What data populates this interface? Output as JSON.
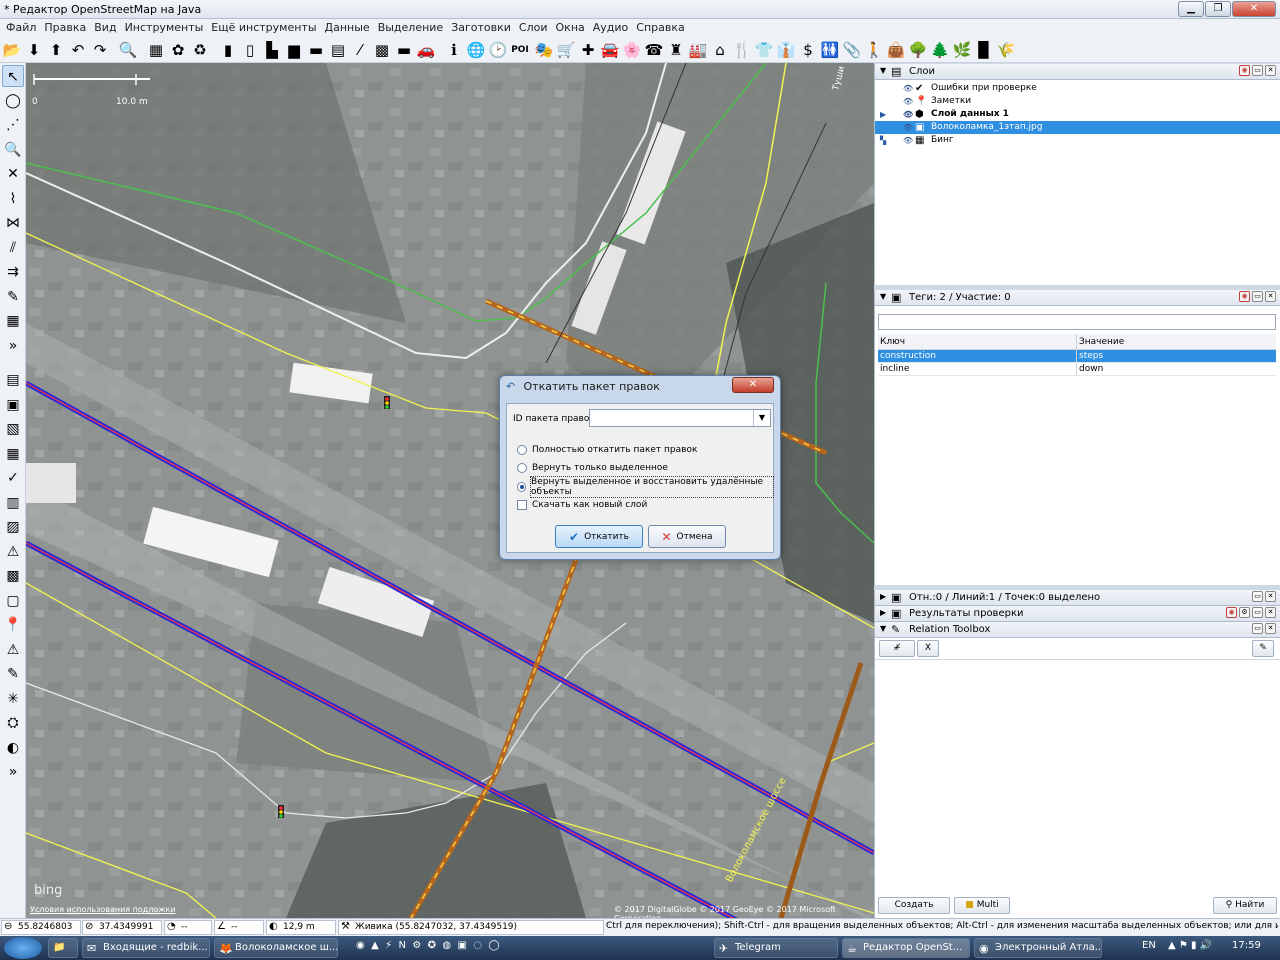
{
  "window": {
    "title": "* Редактор OpenStreetMap на Java",
    "buttons": [
      "▁",
      "❐",
      "✕"
    ]
  },
  "menu": [
    "Файл",
    "Правка",
    "Вид",
    "Инструменты",
    "Ещё инструменты",
    "Данные",
    "Выделение",
    "Заготовки",
    "Слои",
    "Окна",
    "Аудио",
    "Справка"
  ],
  "toolbar": {
    "poi_label": "POI",
    "icons": [
      "open-icon",
      "download-icon",
      "upload-icon",
      "undo-icon",
      "redo-icon",
      "preferences-icon",
      "building-icon",
      "garden-icon",
      "recycle-icon",
      "barrier-icon",
      "pole-icon",
      "gate-icon",
      "door-icon",
      "wall-icon",
      "fence-icon",
      "lines-icon",
      "hedge-icon",
      "rail-icon",
      "car-icon",
      "info-icon",
      "globe-icon",
      "clock-icon",
      "theatre-icon",
      "shop-icon",
      "hospital-icon",
      "car-repair-icon",
      "flower-icon",
      "phone-icon",
      "castle-icon",
      "factory-icon",
      "house-icon",
      "food-icon",
      "clothes-icon",
      "shirt-icon",
      "money-icon",
      "person-icon",
      "paperclip-icon",
      "walker-icon",
      "bag-icon",
      "tree-icon",
      "forest-icon",
      "grass-icon",
      "square-icon",
      "crop-icon"
    ],
    "glyphs": [
      "📂",
      "⬇",
      "⬆",
      "↶",
      "↷",
      "🔍",
      "▦",
      "✿",
      "♻",
      "▮",
      "▯",
      "▙",
      "▆",
      "▬",
      "▤",
      "⁄",
      "▩",
      "▬",
      "🚗",
      "ℹ",
      "🌐",
      "🕑",
      "🎭",
      "🛒",
      "✚",
      "🚘",
      "🌸",
      "☎",
      "♜",
      "🏭",
      "⌂",
      "🍴",
      "👕",
      "👔",
      "$",
      "🚻",
      "📎",
      "🚶",
      "👜",
      "🌳",
      "🌲",
      "🌿",
      "▉",
      "🌾"
    ]
  },
  "left_tools": [
    "select-icon",
    "lasso-icon",
    "draw-icon",
    "zoom-icon",
    "delete-icon",
    "split-icon",
    "combine-icon",
    "parallel-icon",
    "improve-icon",
    "draw-line-icon",
    "building-tool-icon",
    "more-icon",
    "layers-panel-icon",
    "properties-panel-icon",
    "selection-panel-icon",
    "relations-panel-icon",
    "validator-panel-icon",
    "history-panel-icon",
    "changeset-panel-icon",
    "conflict-panel-icon",
    "filter-panel-icon",
    "imagery-panel-icon",
    "notes-panel-icon",
    "warning-panel-icon",
    "map-paint-icon",
    "node-icon",
    "tag-icon",
    "zoom-to-icon",
    "next-icon"
  ],
  "left_glyphs": [
    "↖",
    "◯",
    "⋰",
    "🔍",
    "✕",
    "⌇",
    "⋈",
    "⫽",
    "⇉",
    "✎",
    "▦",
    "»",
    "▤",
    "▣",
    "▧",
    "▦",
    "✓",
    "▥",
    "▨",
    "⚠",
    "▩",
    "▢",
    "📍",
    "⚠",
    "✎",
    "✳",
    "⛭",
    "◐",
    "»"
  ],
  "map": {
    "scale_start": "0",
    "scale_label": "10.0 m",
    "bing_logo": "bing",
    "terms": "Условия использования подложки",
    "copyright": "© 2017 DigitalGlobe © 2017 GeoEye © 2017 Microsoft Corporation",
    "street_label": "Волоколамское шоссе",
    "street_label_top": "Туши"
  },
  "layers_panel": {
    "title": "Слои",
    "layers": [
      {
        "name": "Ошибки при проверке",
        "icon": "✔"
      },
      {
        "name": "Заметки",
        "icon": "📍"
      },
      {
        "name": "Слой данных 1",
        "icon": "⬢"
      },
      {
        "name": "Волоколамка_1этап.jpg",
        "icon": "▣"
      },
      {
        "name": "Бинг",
        "icon": "▦"
      }
    ]
  },
  "tags_panel": {
    "title": "Теги: 2 / Участие: 0",
    "col_key": "Ключ",
    "col_value": "Значение",
    "rows": [
      {
        "key": "construction",
        "value": "steps"
      },
      {
        "key": "incline",
        "value": "down"
      }
    ]
  },
  "selection_panel": {
    "title": "Отн.:0 / Линий:1 / Точек:0 выделено"
  },
  "validation_panel": {
    "title": "Результаты проверки"
  },
  "relation_toolbox": {
    "title": "Relation Toolbox",
    "add_btn": "+̸",
    "remove_btn": "X",
    "edit_btn": "✎",
    "create_btn": "Создать",
    "multi_btn": "Multi",
    "find_btn": "Найти"
  },
  "dialog": {
    "title": "Откатить пакет правок",
    "close": "✕",
    "id_label": "ID пакета правок:",
    "id_value": "",
    "options": [
      {
        "label": "Полностью откатить пакет правок",
        "selected": false
      },
      {
        "label": "Вернуть только выделенное",
        "selected": false
      },
      {
        "label": "Вернуть выделенное и восстановить удалённые объекты",
        "selected": true
      }
    ],
    "new_layer_label": "Скачать как новый слой",
    "new_layer_checked": false,
    "ok_label": "Откатить",
    "cancel_label": "Отмена"
  },
  "statusbar": {
    "lat": "55.8246803",
    "lon": "37.4349991",
    "heading": "--",
    "angle": "--",
    "distance": "12,9 m",
    "name": "Живика (55.8247032, 37.4349519)",
    "help": "Ctrl для переключения); Shift-Ctrl - для вращения выделенных объектов; Alt-Ctrl - для изменения масштаба выделенных объектов; или для изменения выделения"
  },
  "taskbar": {
    "tasks": [
      {
        "label": "",
        "icon": "📁"
      },
      {
        "label": "Входящие - redbik...",
        "icon": "✉"
      },
      {
        "label": "Волоколамское ш...",
        "icon": "🦊"
      },
      {
        "label": "Telegram",
        "icon": "✈"
      },
      {
        "label": "Редактор OpenSt...",
        "icon": "☕"
      },
      {
        "label": "Электронный Атла...",
        "icon": "◉"
      }
    ],
    "lang": "EN",
    "time": "17:59"
  },
  "colors": {
    "accent": "#2f8fe0",
    "road_blue": "#2b2bd6",
    "construction": "#b5651d",
    "footway_yellow": "#f2f250",
    "green_line": "#4cbf4c"
  }
}
